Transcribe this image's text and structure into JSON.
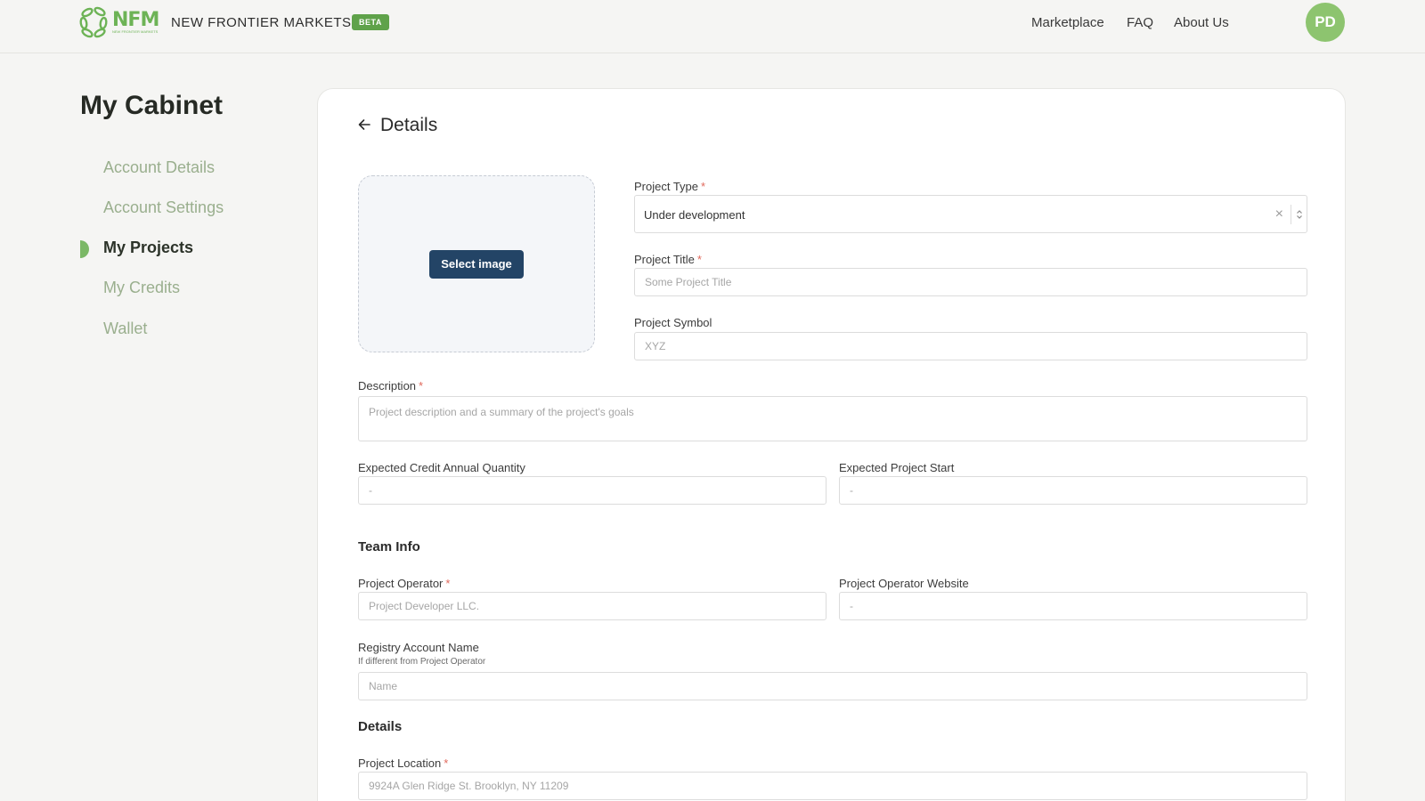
{
  "header": {
    "logo_text": "NFM",
    "logo_tagline": "NEW FRONTIER MARKETS",
    "brand_name": "NEW FRONTIER MARKETS",
    "beta_badge": "BETA",
    "nav": [
      "Marketplace",
      "FAQ",
      "About Us"
    ],
    "avatar_initials": "PD"
  },
  "sidebar": {
    "title": "My Cabinet",
    "items": [
      {
        "label": "Account Details",
        "active": false
      },
      {
        "label": "Account Settings",
        "active": false
      },
      {
        "label": "My Projects",
        "active": true
      },
      {
        "label": "My Credits",
        "active": false
      },
      {
        "label": "Wallet",
        "active": false
      }
    ]
  },
  "main": {
    "title": "Details",
    "select_image_label": "Select image",
    "project_type": {
      "label": "Project Type",
      "required": "*",
      "value": "Under development"
    },
    "project_title": {
      "label": "Project Title",
      "required": "*",
      "placeholder": "Some Project Title"
    },
    "project_symbol": {
      "label": "Project Symbol",
      "placeholder": "XYZ"
    },
    "description": {
      "label": "Description",
      "required": "*",
      "placeholder": "Project description and a summary of the project's goals"
    },
    "annual_quantity": {
      "label": "Expected Credit Annual Quantity",
      "placeholder": "-"
    },
    "project_start": {
      "label": "Expected Project Start",
      "placeholder": "-"
    },
    "team_heading": "Team Info",
    "operator": {
      "label": "Project Operator",
      "required": "*",
      "placeholder": "Project Developer LLC."
    },
    "operator_website": {
      "label": "Project Operator Website",
      "placeholder": "-"
    },
    "registry": {
      "label": "Registry Account Name",
      "hint": "If different from Project Operator",
      "placeholder": "Name"
    },
    "details_heading": "Details",
    "location": {
      "label": "Project Location",
      "required": "*",
      "placeholder": "9924A Glen Ridge St. Brooklyn, NY 11209"
    }
  },
  "colors": {
    "brand_green": "#6db356",
    "active_green": "#7bb866",
    "inactive_sidebar": "#9aaf8e",
    "primary_button": "#234466",
    "required_star": "#e0695c"
  }
}
